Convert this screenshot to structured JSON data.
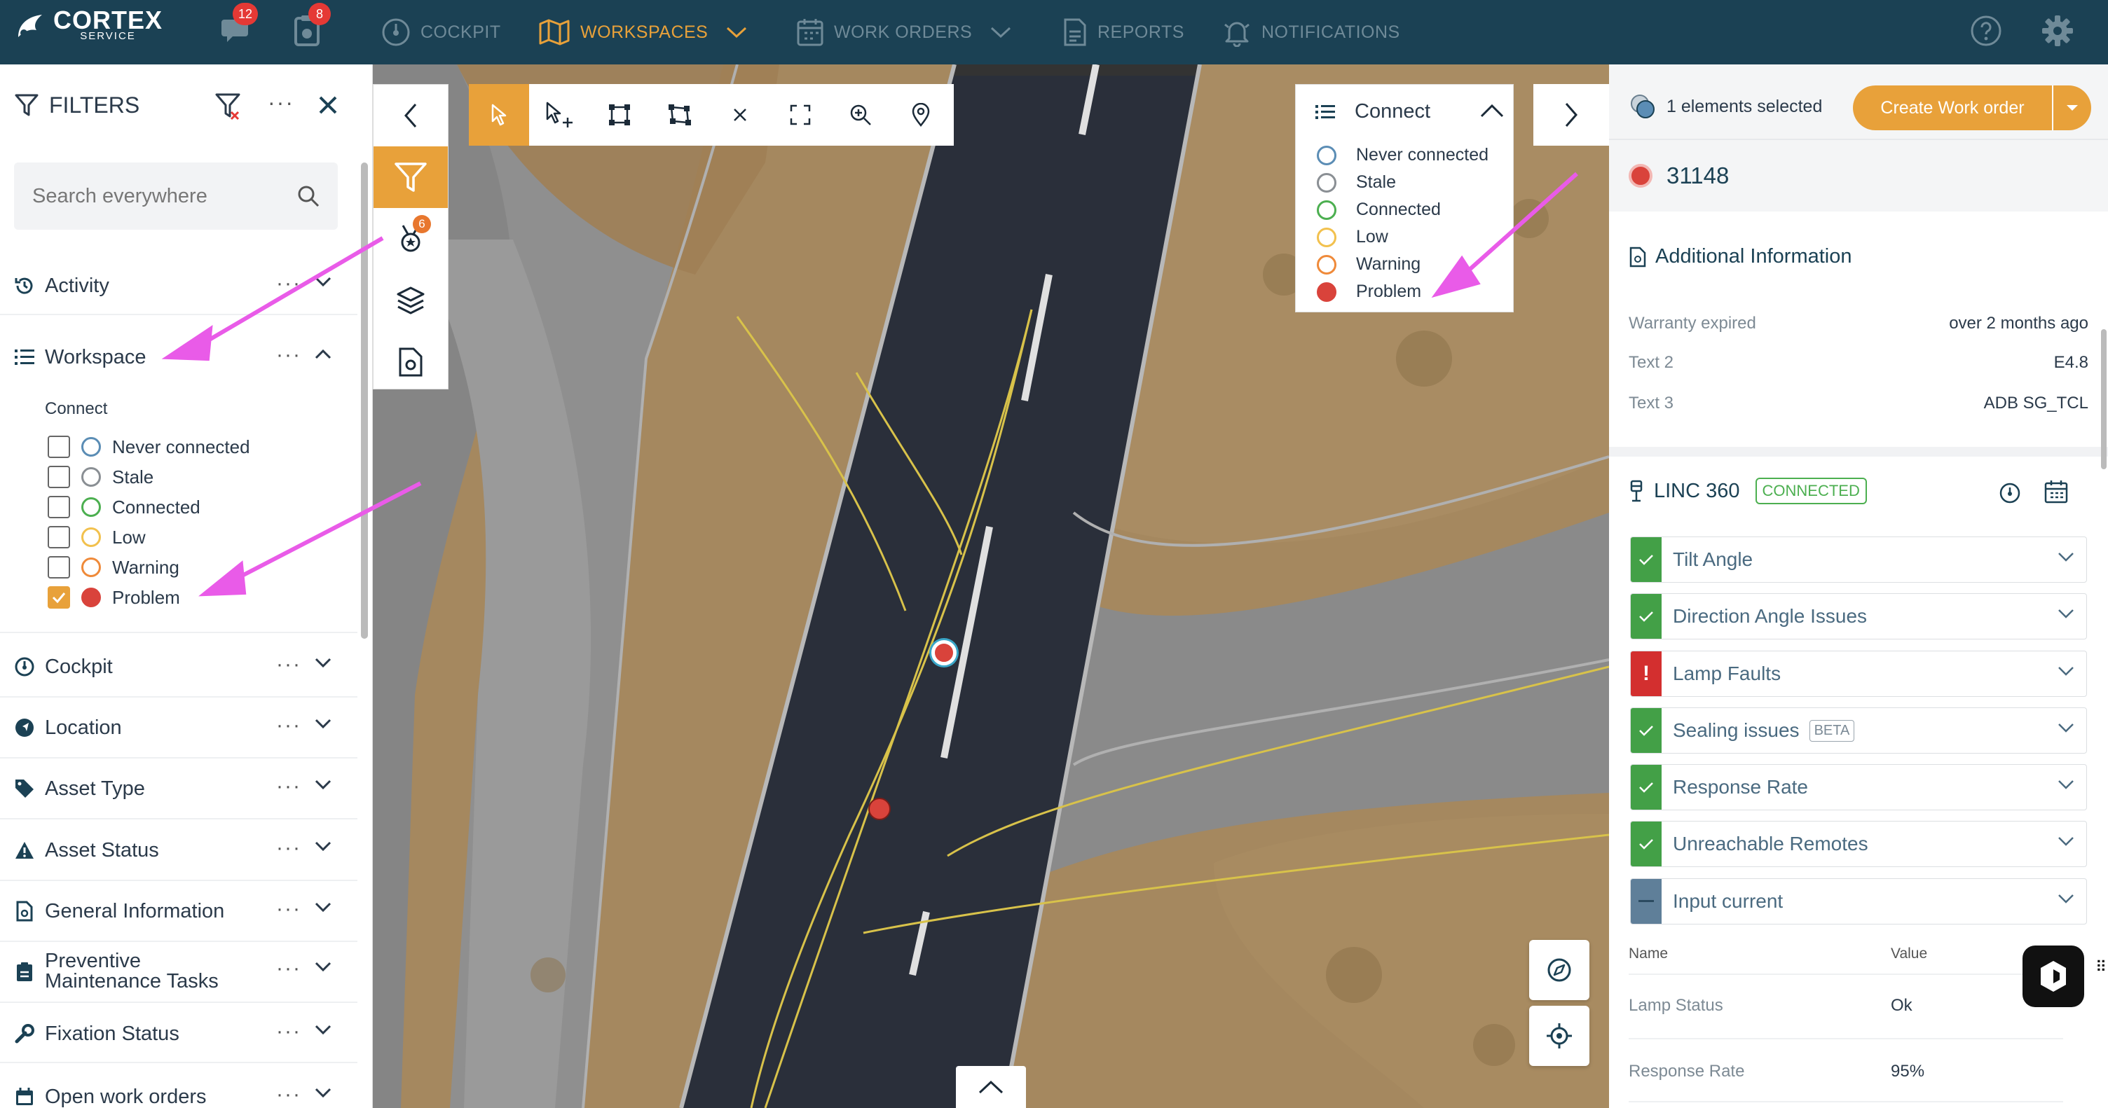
{
  "topbar": {
    "logo_word": "CORTEX",
    "logo_sub": "SERVICE",
    "chat_badge": "12",
    "task_badge": "8",
    "nav": [
      {
        "label": "COCKPIT"
      },
      {
        "label": "WORKSPACES"
      },
      {
        "label": "WORK ORDERS"
      },
      {
        "label": "REPORTS"
      },
      {
        "label": "NOTIFICATIONS"
      }
    ],
    "accent_color": "#e8a13a",
    "bar_color": "#1b4154"
  },
  "filters": {
    "title": "FILTERS",
    "search_placeholder": "Search everywhere",
    "sections": [
      {
        "label": "Activity"
      },
      {
        "label": "Workspace"
      },
      {
        "label": "Cockpit"
      },
      {
        "label": "Location"
      },
      {
        "label": "Asset Type"
      },
      {
        "label": "Asset Status"
      },
      {
        "label": "General Information"
      },
      {
        "label": "Preventive"
      },
      {
        "label": "Fixation Status"
      },
      {
        "label": "Open work orders"
      }
    ],
    "preventive_line2": "Maintenance Tasks",
    "workspace_group_label": "Connect",
    "status_options": [
      {
        "label": "Never connected",
        "checked": false,
        "color": "#5b8db5"
      },
      {
        "label": "Stale",
        "checked": false,
        "color": "#8a8f94"
      },
      {
        "label": "Connected",
        "checked": false,
        "color": "#4caf50"
      },
      {
        "label": "Low",
        "checked": false,
        "color": "#f2c14e"
      },
      {
        "label": "Warning",
        "checked": false,
        "color": "#ef8a3a"
      },
      {
        "label": "Problem",
        "checked": true,
        "color": "#d9433b"
      }
    ]
  },
  "map": {
    "filter_badge": "6",
    "legend": {
      "title": "Connect",
      "items": [
        {
          "label": "Never connected"
        },
        {
          "label": "Stale"
        },
        {
          "label": "Connected"
        },
        {
          "label": "Low"
        },
        {
          "label": "Warning"
        },
        {
          "label": "Problem"
        }
      ]
    }
  },
  "details": {
    "selection_text": "1 elements selected",
    "create_button": "Create Work order",
    "asset_id": "31148",
    "additional_info_title": "Additional Information",
    "info_rows": [
      {
        "key": "Warranty expired",
        "value": "over 2 months ago"
      },
      {
        "key": "Text 2",
        "value": "E4.8"
      },
      {
        "key": "Text 3",
        "value": "ADB SG_TCL"
      }
    ],
    "device": "LINC 360",
    "device_status": "CONNECTED",
    "checks": [
      {
        "label": "Tilt Angle",
        "status": "ok"
      },
      {
        "label": "Direction Angle Issues",
        "status": "ok"
      },
      {
        "label": "Lamp Faults",
        "status": "error"
      },
      {
        "label": "Sealing issues",
        "status": "ok"
      },
      {
        "label": "Response Rate",
        "status": "ok"
      },
      {
        "label": "Unreachable Remotes",
        "status": "ok"
      },
      {
        "label": "Input current",
        "status": "neutral"
      }
    ],
    "beta_label": "BETA",
    "table": {
      "headers": [
        "Name",
        "Value"
      ],
      "rows": [
        {
          "name": "Lamp Status",
          "value": "Ok"
        },
        {
          "name": "Response Rate",
          "value": "95%"
        }
      ]
    }
  }
}
